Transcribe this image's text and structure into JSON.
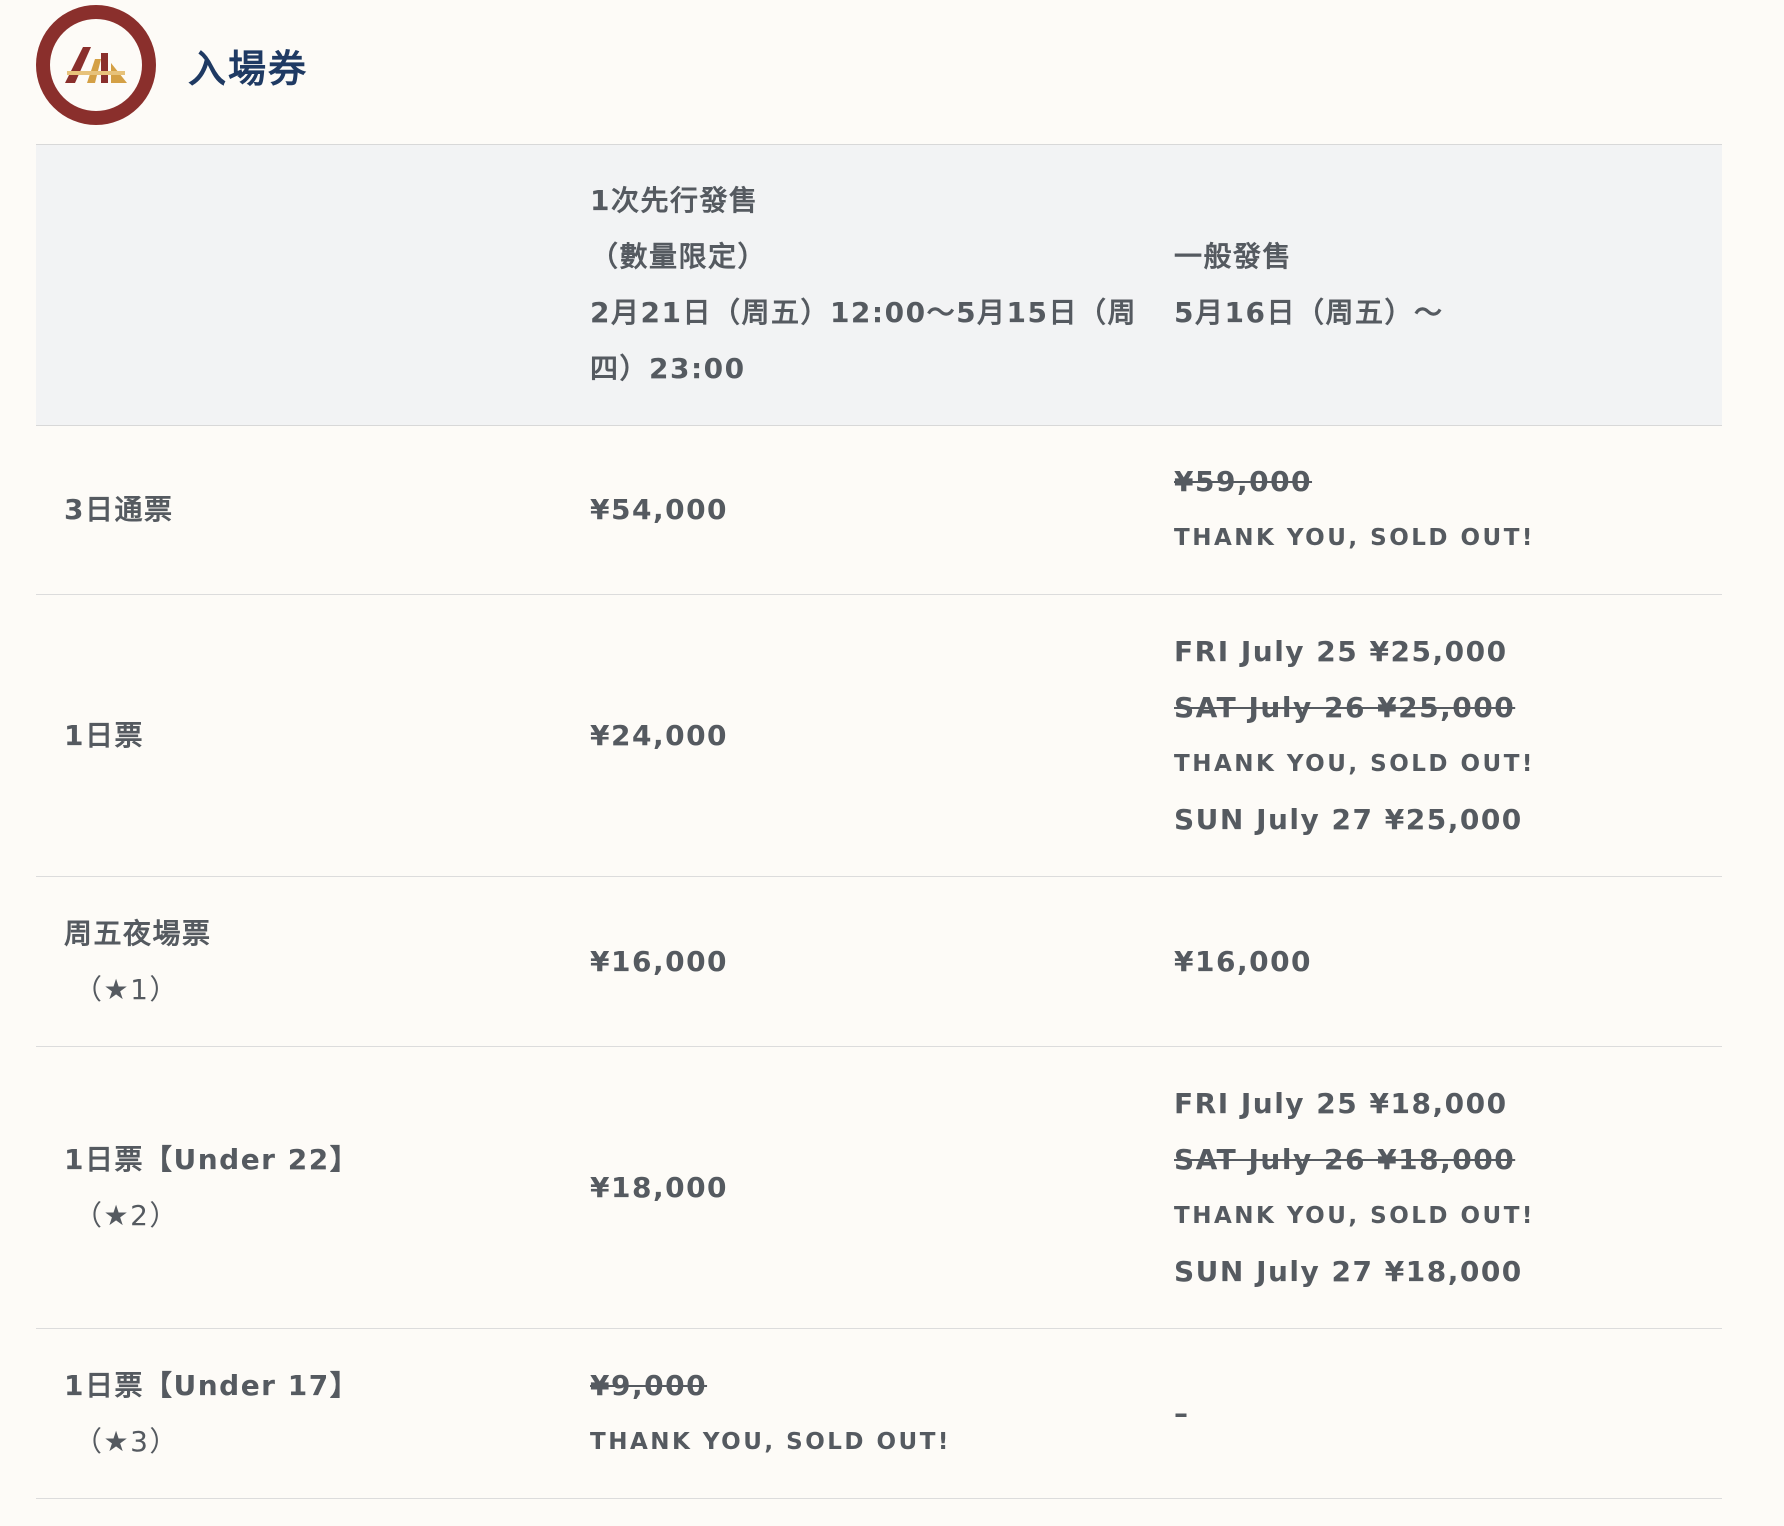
{
  "section": {
    "title": "入場券"
  },
  "header_row": {
    "presale_line1": "1次先行發售",
    "presale_line2": "（數量限定）",
    "presale_line3": "2月21日（周五）12:00〜5月15日（周",
    "presale_line4": "四）23:00",
    "general_line1": "一般發售",
    "general_line2": "5月16日（周五）〜"
  },
  "rows": [
    {
      "name": "3日通票",
      "presale": "¥54,000",
      "general": [
        {
          "text": "¥59,000"
        },
        {
          "text": "THANK YOU, SOLD OUT!"
        }
      ]
    },
    {
      "name": "1日票",
      "presale": "¥24,000",
      "general": [
        {
          "text": "FRI July 25 ¥25,000"
        },
        {
          "text": "SAT July 26 ¥25,000"
        },
        {
          "text": "THANK YOU, SOLD OUT!"
        },
        {
          "text": "SUN July 27 ¥25,000"
        }
      ]
    },
    {
      "name": "周五夜場票",
      "note": "（★1）",
      "presale": "¥16,000",
      "general": [
        {
          "text": "¥16,000"
        }
      ]
    },
    {
      "name": "1日票【Under 22】",
      "note": "（★2）",
      "presale": "¥18,000",
      "general": [
        {
          "text": "FRI July 25 ¥18,000"
        },
        {
          "text": "SAT July 26 ¥18,000"
        },
        {
          "text": "THANK YOU, SOLD OUT!"
        },
        {
          "text": "SUN July 27 ¥18,000"
        }
      ]
    },
    {
      "name": "1日票【Under 17】",
      "note": "（★3）",
      "presale": "¥9,000",
      "presale_sold": "THANK YOU, SOLD OUT!",
      "general": [
        {
          "text": "–"
        }
      ]
    }
  ],
  "colors": {
    "title": "#1f3a63",
    "accent_gold": "#e8b54a",
    "body_text": "#555a60",
    "logo_ring": "#8a2f2c",
    "header_bg": "#f2f3f4",
    "page_bg": "#fdfbf7"
  },
  "icons": {
    "logo": "festival-logo"
  }
}
